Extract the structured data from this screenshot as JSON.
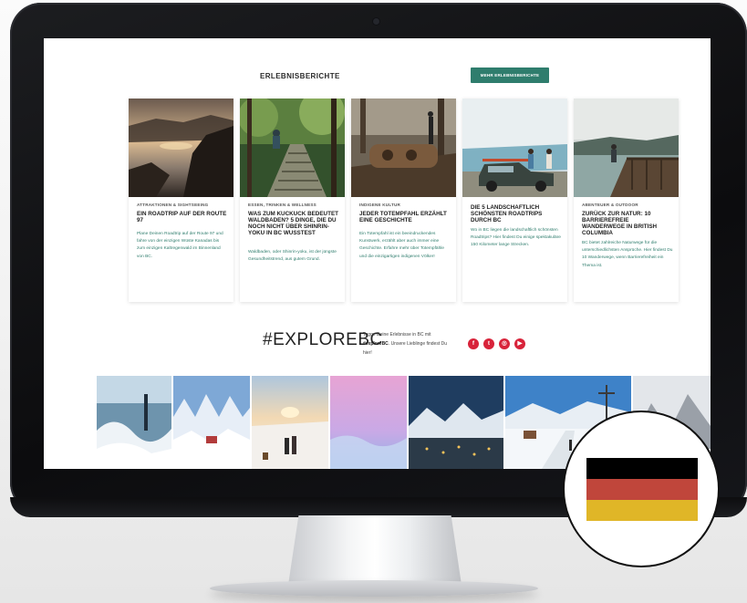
{
  "section": {
    "title": "ERLEBNISBERICHTE",
    "more_button": "MEHR ERLEBNISBERICHTE"
  },
  "cards": [
    {
      "category": "ATTRAKTIONEN & SIGHTSEEING",
      "title": "EIN ROADTRIP AUF DER ROUTE 97",
      "text": "Plane Deinen Roadtrip auf der Route 97 und fahre von der einzigen Wüste Kanadas bis zum einzigen Kaltregenwald im Binnenland von BC."
    },
    {
      "category": "ESSEN, TRINKEN & WELLNESS",
      "title": "WAS ZUM KUCKUCK BEDEUTET WALDBADEN? 5 DINGE, DIE DU NOCH NICHT ÜBER SHINRIN-YOKU IN BC WUSSTEST",
      "text": "Waldbaden, oder Shinrin-yoku, ist der jüngste Gesundheitstrend, aus gutem Grund."
    },
    {
      "category": "INDIGENE KULTUR",
      "title": "JEDER TOTEMPFAHL ERZÄHLT EINE GESCHICHTE",
      "text": "Ein Totempfahl ist ein beeindruckendes Kunstwerk, erzählt aber auch immer eine Geschichte. Erfahre mehr über Totempfähle und die einzigartigen indigenen Völker!"
    },
    {
      "category": "",
      "title": "DIE 5 LANDSCHAFTLICH SCHÖNSTEN ROADTRIPS DURCH BC",
      "text": "Wo in BC liegen die landschaftlich schönsten Roadtrips? Hier findest Du einige spektakuläre 150 Kilometer lange Strecken."
    },
    {
      "category": "ABENTEUER & OUTDOOR",
      "title": "ZURÜCK ZUR NATUR: 10 BARRIEREFREIE WANDERWEGE IN BRITISH COLUMBIA",
      "text": "BC bietet zahlreiche Naturwege für die unterschiedlichsten Ansprüche. Hier findest Du 10 Wanderwege, wenn Barrierefreiheit ein Thema ist."
    }
  ],
  "explore": {
    "hashtag": "#EXPLOREBC",
    "text_prefix": "Tagge Deine Erlebnisse in BC mit ",
    "text_bold": "#exploreBC",
    "text_suffix": ". Unsere Lieblinge findest Du hier!"
  },
  "social": [
    {
      "icon": "facebook-icon",
      "glyph": "f",
      "color": "#d8233a"
    },
    {
      "icon": "twitter-icon",
      "glyph": "t",
      "color": "#d8233a"
    },
    {
      "icon": "instagram-icon",
      "glyph": "◎",
      "color": "#d8233a"
    },
    {
      "icon": "youtube-icon",
      "glyph": "▶",
      "color": "#d8233a"
    }
  ],
  "flag": {
    "colors": [
      "#000000",
      "#c0463b",
      "#e0b627"
    ]
  }
}
